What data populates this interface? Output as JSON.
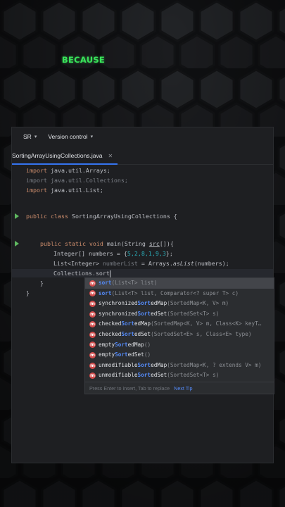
{
  "caption": "BECAUSE",
  "toolbar": {
    "project": "SR",
    "vcs": "Version control"
  },
  "tab": {
    "label": "SortingArrayUsingCollections.java"
  },
  "code": {
    "l1_kw": "import",
    "l1_rest": " java.util.Arrays;",
    "l2": "import java.util.Collections;",
    "l3_kw": "import",
    "l3_rest": " java.util.List;",
    "l4_kw": "public class",
    "l4_rest": " SortingArrayUsingCollections {",
    "l5_kw": "public static void",
    "l5_a": " main(String ",
    "l5_und": "src",
    "l5_b": "[]){",
    "l6_a": "Integer[] numbers = {",
    "l6_b": "5,2,8,1,9,3",
    "l6_c": "};",
    "l7_a": "List<Integer> ",
    "l7_gray": "numberList",
    "l7_b": " = Arrays.",
    "l7_it": "asList",
    "l7_c": "(numbers);",
    "l8": "Collections.sort",
    "l9": "}",
    "l10": "}"
  },
  "completion": {
    "items": [
      {
        "pre": "",
        "match": "sort",
        "post": "",
        "sig": "(List<T> list)"
      },
      {
        "pre": "",
        "match": "sort",
        "post": "",
        "sig": "(List<T> list, Comparator<? super T> c)"
      },
      {
        "pre": "synchronized",
        "match": "Sort",
        "post": "edMap",
        "sig": "(SortedMap<K, V> m)"
      },
      {
        "pre": "synchronized",
        "match": "Sort",
        "post": "edSet",
        "sig": "(SortedSet<T> s)"
      },
      {
        "pre": "checked",
        "match": "Sort",
        "post": "edMap",
        "sig": "(SortedMap<K, V> m, Class<K> keyT…"
      },
      {
        "pre": "checked",
        "match": "Sort",
        "post": "edSet",
        "sig": "(SortedSet<E> s, Class<E> type)"
      },
      {
        "pre": "empty",
        "match": "Sort",
        "post": "edMap",
        "sig": "()"
      },
      {
        "pre": "empty",
        "match": "Sort",
        "post": "edSet",
        "sig": "()"
      },
      {
        "pre": "unmodifiable",
        "match": "Sort",
        "post": "edMap",
        "sig": "(SortedMap<K, ? extends V> m)"
      },
      {
        "pre": "unmodifiable",
        "match": "Sort",
        "post": "edSet",
        "sig": "(SortedSet<T> s)"
      }
    ],
    "icon_letter": "m",
    "footer_hint": "Press Enter to insert, Tab to replace",
    "footer_link": "Next Tip"
  },
  "colors": {
    "accent": "#3574f0",
    "caption": "#39e35a",
    "keyword": "#cf8e6d",
    "match": "#548af7",
    "method_icon": "#d34c4c"
  }
}
